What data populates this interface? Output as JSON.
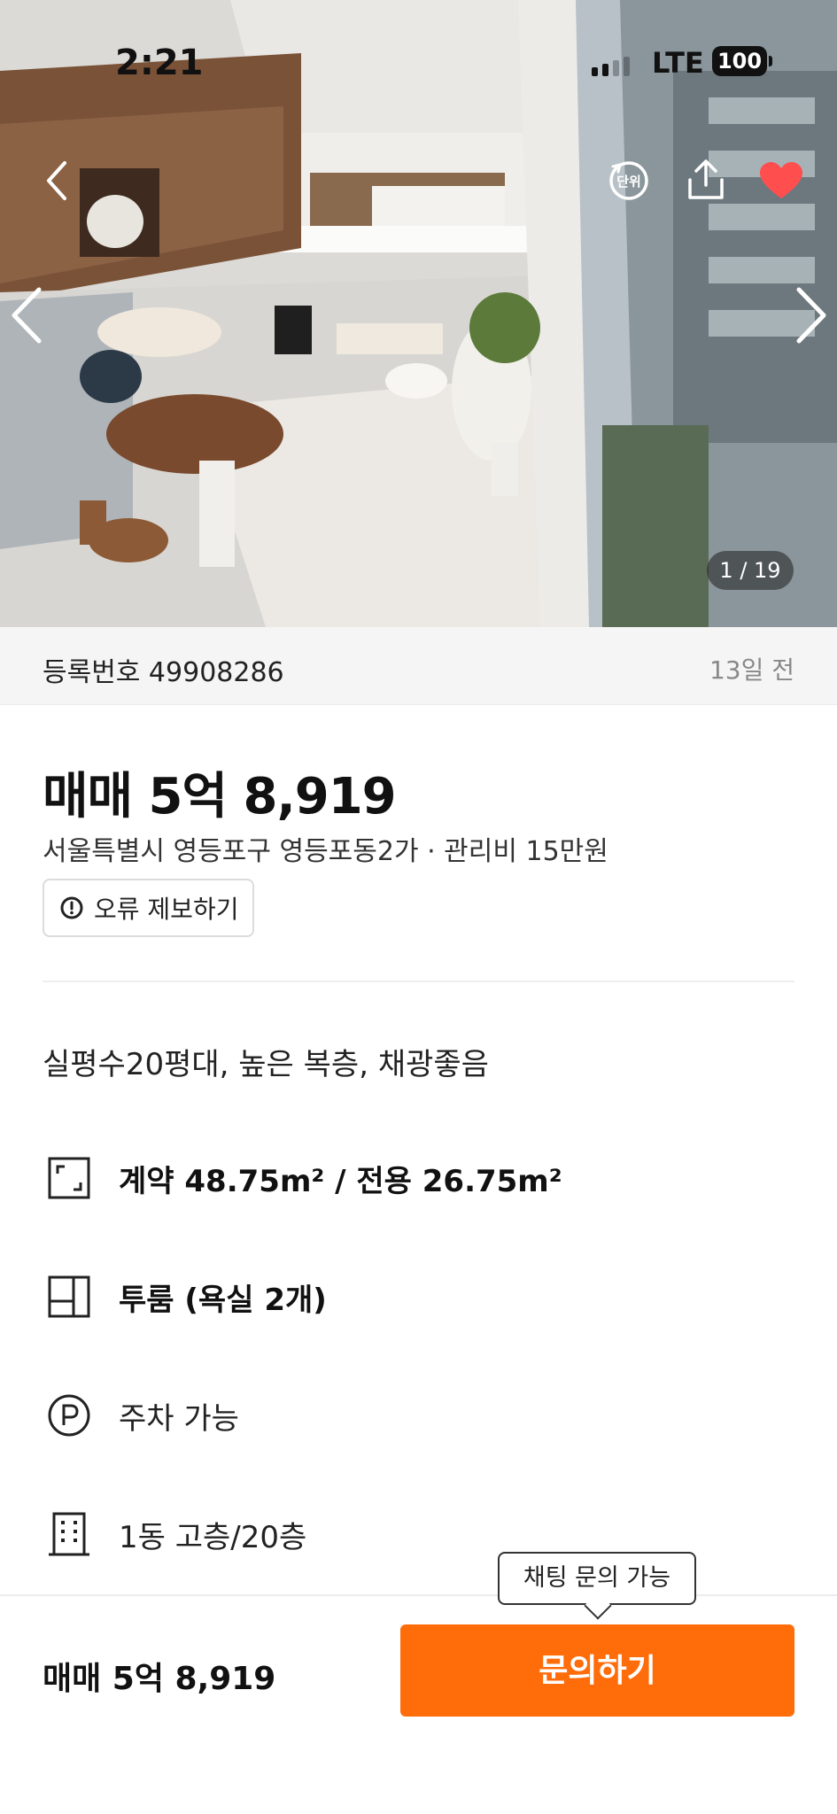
{
  "status_bar": {
    "time": "2:21",
    "network": "LTE",
    "battery": "100"
  },
  "gallery": {
    "counter": "1 / 19",
    "icons": {
      "back": "chevron-left-icon",
      "unit": "unit-toggle-icon",
      "unit_label": "단위",
      "share": "share-icon",
      "favorite": "heart-icon",
      "prev": "chevron-left-icon",
      "next": "chevron-right-icon"
    },
    "favorite_color": "#ff4e4e"
  },
  "listing": {
    "registration": "등록번호 49908286",
    "posted": "13일 전",
    "price": "매매 5억 8,919",
    "address": "서울특별시 영등포구 영등포동2가  · 관리비 15만원",
    "report_label": "오류 제보하기",
    "description": "실평수20평대, 높은 복층, 채광좋음",
    "features": [
      {
        "icon": "area-icon",
        "label": "계약 48.75m² / 전용 26.75m²"
      },
      {
        "icon": "room-layout-icon",
        "label": "투룸 (욕실 2개)"
      },
      {
        "icon": "parking-icon",
        "label": "주차 가능"
      },
      {
        "icon": "building-icon",
        "label": "1동 고층/20층"
      }
    ]
  },
  "bottom_bar": {
    "price": "매매 5억 8,919",
    "cta_label": "문의하기",
    "tooltip": "채팅 문의 가능",
    "accent": "#ff6c0a"
  }
}
